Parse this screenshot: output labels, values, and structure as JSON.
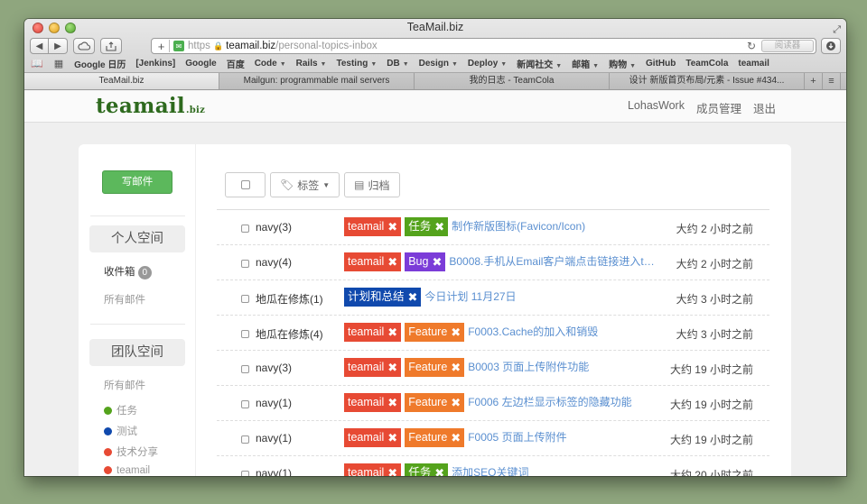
{
  "window": {
    "title": "TeaMail.biz",
    "url_scheme": "https",
    "url_domain": "teamail.biz",
    "url_path": "/personal-topics-inbox",
    "reader_label": "阅读器"
  },
  "bookmarks": [
    "Google 日历",
    "[Jenkins]",
    "Google",
    "百度",
    "Code",
    "Rails",
    "Testing",
    "DB",
    "Design",
    "Deploy",
    "新闻社交",
    "邮箱",
    "购物",
    "GitHub",
    "TeamCola",
    "teamail"
  ],
  "bookmarks_with_menu": [
    false,
    false,
    false,
    false,
    true,
    true,
    true,
    true,
    true,
    true,
    true,
    true,
    true,
    false,
    false,
    false
  ],
  "tabs": [
    {
      "label": "TeaMail.biz",
      "active": true
    },
    {
      "label": "Mailgun: programmable mail servers",
      "active": false
    },
    {
      "label": "我的日志 - TeamCola",
      "active": false
    },
    {
      "label": "设计 新版首页布局/元素 - Issue #434...",
      "active": false
    }
  ],
  "header": {
    "logo": "teamail",
    "logo_suffix": ".biz",
    "nav": [
      "LohasWork",
      "成员管理",
      "退出"
    ]
  },
  "sidebar": {
    "compose_label": "写邮件",
    "personal_title": "个人空间",
    "inbox_label": "收件箱",
    "inbox_count": "0",
    "all_mail_personal": "所有邮件",
    "team_title": "团队空间",
    "all_mail_team": "所有邮件",
    "team_labels": [
      {
        "label": "任务",
        "color": "#54a31c"
      },
      {
        "label": "测试",
        "color": "#1049ad"
      },
      {
        "label": "技术分享",
        "color": "#e74a34"
      },
      {
        "label": "teamail",
        "color": "#e74a34"
      }
    ]
  },
  "toolbar": {
    "tags_label": "标签",
    "archive_label": "归档"
  },
  "messages": [
    {
      "sender": "navy(3)",
      "tags": [
        {
          "label": "teamail",
          "color": "red"
        },
        {
          "label": "任务",
          "color": "green"
        }
      ],
      "subject": "制作新版图标(Favicon/Icon)",
      "time": "大约 2 小时之前"
    },
    {
      "sender": "navy(4)",
      "tags": [
        {
          "label": "teamail",
          "color": "red"
        },
        {
          "label": "Bug",
          "color": "purple"
        }
      ],
      "subject": "B0008.手机从Email客户端点击链接进入to…",
      "time": "大约 2 小时之前"
    },
    {
      "sender": "地瓜在修炼(1)",
      "tags": [
        {
          "label": "计划和总结",
          "color": "blue"
        }
      ],
      "subject": "今日计划 11月27日",
      "time": "大约 3 小时之前"
    },
    {
      "sender": "地瓜在修炼(4)",
      "tags": [
        {
          "label": "teamail",
          "color": "red"
        },
        {
          "label": "Feature",
          "color": "orange"
        }
      ],
      "subject": "F0003.Cache的加入和销毁",
      "time": "大约 3 小时之前"
    },
    {
      "sender": "navy(3)",
      "tags": [
        {
          "label": "teamail",
          "color": "red"
        },
        {
          "label": "Feature",
          "color": "orange"
        }
      ],
      "subject": "B0003 页面上传附件功能",
      "time": "大约 19 小时之前"
    },
    {
      "sender": "navy(1)",
      "tags": [
        {
          "label": "teamail",
          "color": "red"
        },
        {
          "label": "Feature",
          "color": "orange"
        }
      ],
      "subject": "F0006 左边栏显示标签的隐藏功能",
      "time": "大约 19 小时之前"
    },
    {
      "sender": "navy(1)",
      "tags": [
        {
          "label": "teamail",
          "color": "red"
        },
        {
          "label": "Feature",
          "color": "orange"
        }
      ],
      "subject": "F0005 页面上传附件",
      "time": "大约 19 小时之前"
    },
    {
      "sender": "navy(1)",
      "tags": [
        {
          "label": "teamail",
          "color": "red"
        },
        {
          "label": "任务",
          "color": "green"
        }
      ],
      "subject": "添加SEO关键词",
      "time": "大约 20 小时之前"
    }
  ]
}
